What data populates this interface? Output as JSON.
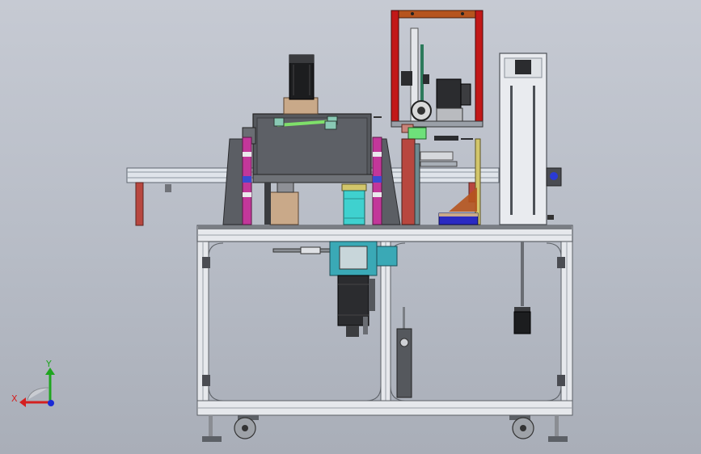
{
  "triad": {
    "x_label": "X",
    "y_label": "Y",
    "x_color": "#d42020",
    "y_color": "#1fa51f",
    "z_color": "#1a2ad6"
  },
  "palette": {
    "frame": "#e6e8ec",
    "frame_edge": "#5c6066",
    "housing": "#56595e",
    "red_frame": "#c21818",
    "magenta": "#c2379a",
    "cyan": "#3fd1cf",
    "green_rod": "#7fe06a",
    "tan": "#c9a989",
    "dark": "#2b2c2f"
  }
}
